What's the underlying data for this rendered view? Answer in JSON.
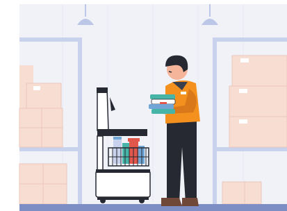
{
  "illustration": {
    "subject": "warehouse-worker-loading-delivery-robot",
    "colors": {
      "wall": "#f1f2f8",
      "shelf": "#c9d2ec",
      "box": "#f8ddd3",
      "box_dark": "#ecc6b8",
      "floor": "#7c8ec3",
      "lamp": "#bcc6e6",
      "jacket": "#f4901e",
      "jacket_dark": "#d8781a",
      "pants": "#262932",
      "hair": "#262932",
      "skin": "#f4b59b",
      "robot_body": "#ffffff",
      "robot_dark": "#262932",
      "book_teal": "#46b4a6",
      "book_red": "#e2574c",
      "book_blue": "#6fa6d6"
    }
  }
}
